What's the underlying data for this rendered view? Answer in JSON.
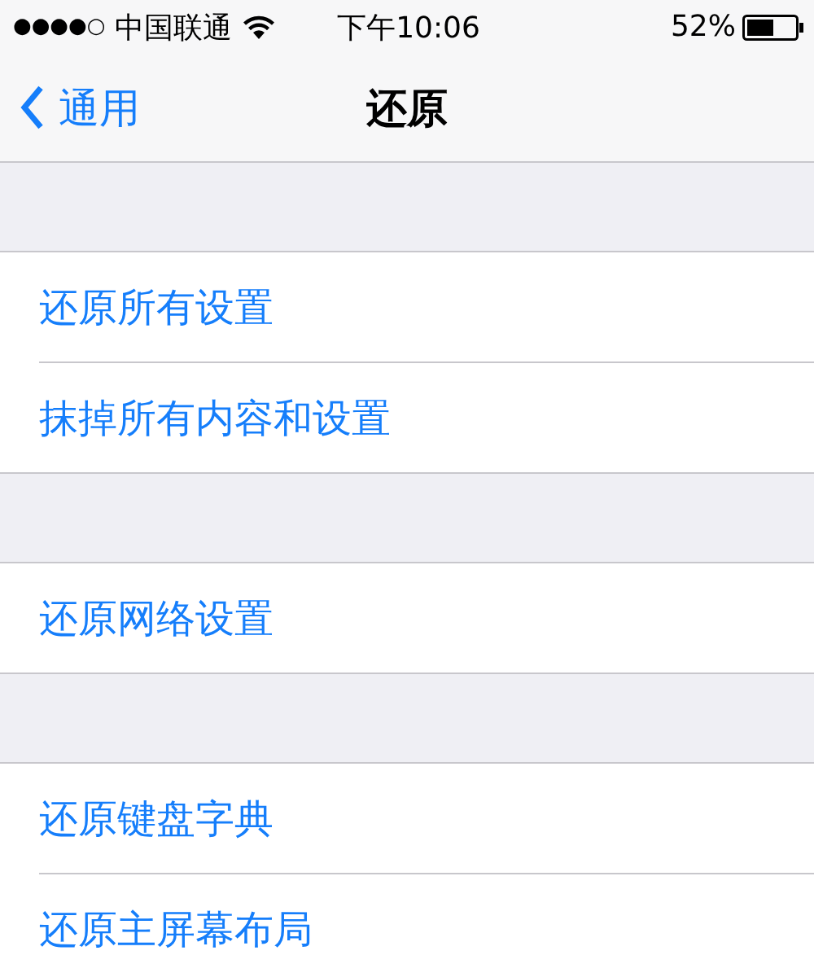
{
  "status_bar": {
    "signal": "●●●●○",
    "carrier": "中国联通",
    "time": "下午10:06",
    "battery": "52%"
  },
  "nav_bar": {
    "back": "通用",
    "title": "还原"
  },
  "groups": [
    {
      "items": [
        "还原所有设置",
        "抹掉所有内容和设置"
      ]
    },
    {
      "items": [
        "还原网络设置"
      ]
    },
    {
      "items": [
        "还原键盘字典",
        "还原主屏幕布局"
      ]
    }
  ]
}
